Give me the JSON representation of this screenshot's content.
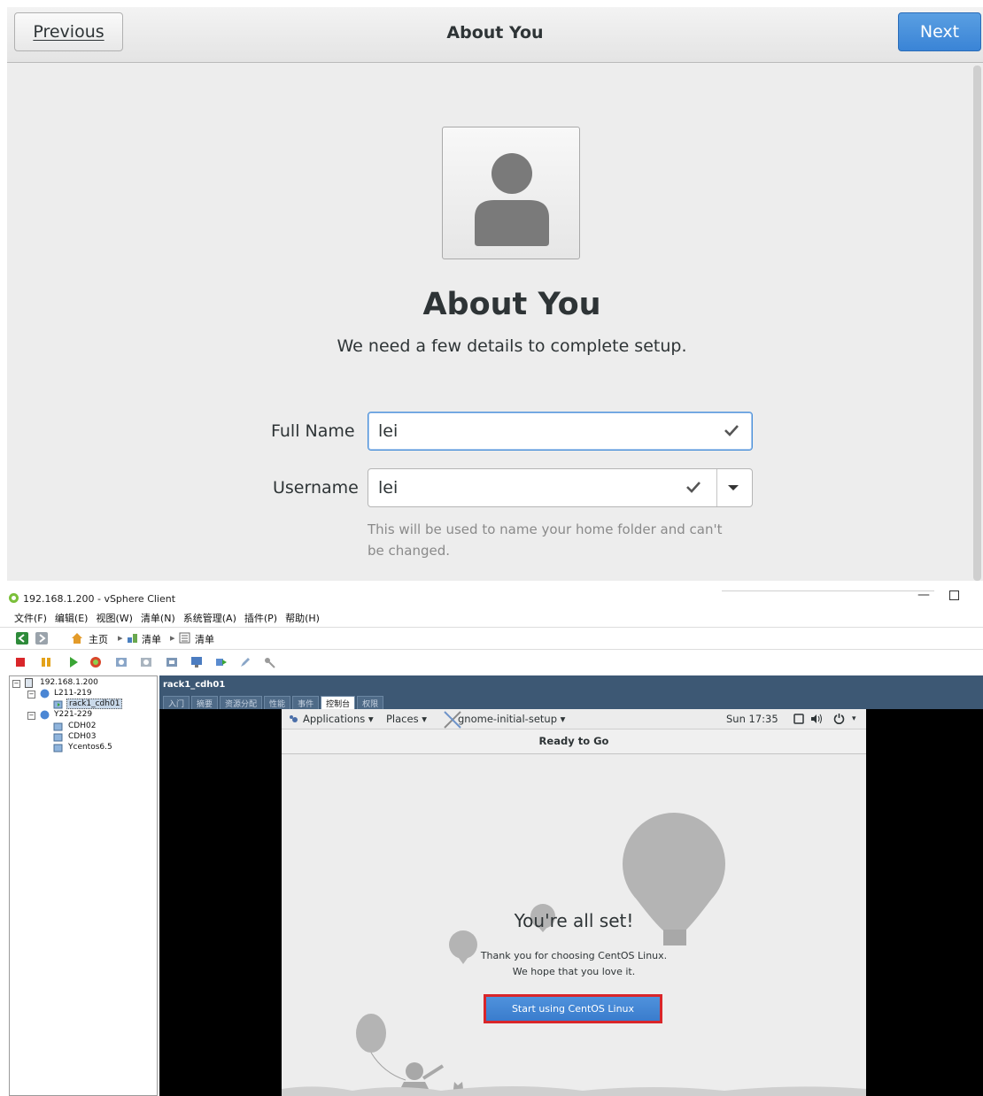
{
  "gnome_about": {
    "header": {
      "previous_label": "Previous",
      "title": "About You",
      "next_label": "Next"
    },
    "page_title": "About You",
    "subtitle": "We need a few details to complete setup.",
    "full_name": {
      "label": "Full Name",
      "value": "lei"
    },
    "username": {
      "label": "Username",
      "value": "lei"
    },
    "hint": "This will be used to name your home folder and can't be changed."
  },
  "vsphere": {
    "window_title": "192.168.1.200 - vSphere Client",
    "menu": [
      "文件(F)",
      "编辑(E)",
      "视图(W)",
      "清单(N)",
      "系统管理(A)",
      "插件(P)",
      "帮助(H)"
    ],
    "breadcrumb": [
      "主页",
      "清单",
      "清单"
    ],
    "tree": {
      "root": "192.168.1.200",
      "group1": "L211-219",
      "vm1": "rack1_cdh01",
      "group2": "Y221-229",
      "vm2": "CDH02",
      "vm3": "CDH03",
      "vm4": "Ycentos6.5"
    },
    "vm_name": "rack1_cdh01",
    "tabs": [
      "入门",
      "摘要",
      "资源分配",
      "性能",
      "事件",
      "控制台",
      "权限"
    ],
    "active_tab": "控制台"
  },
  "console": {
    "topbar": {
      "applications": "Applications ▾",
      "places": "Places ▾",
      "app_name": "gnome-initial-setup ▾",
      "clock": "Sun 17:35"
    },
    "header_title": "Ready to Go",
    "done_title": "You're all set!",
    "thanks_line1": "Thank you for choosing CentOS Linux.",
    "thanks_line2": "We hope that you love it.",
    "start_button": "Start using CentOS Linux"
  },
  "colors": {
    "gnome_blue": "#4a90d9",
    "vsphere_header": "#3d5874",
    "highlight_red": "#d9262a"
  }
}
